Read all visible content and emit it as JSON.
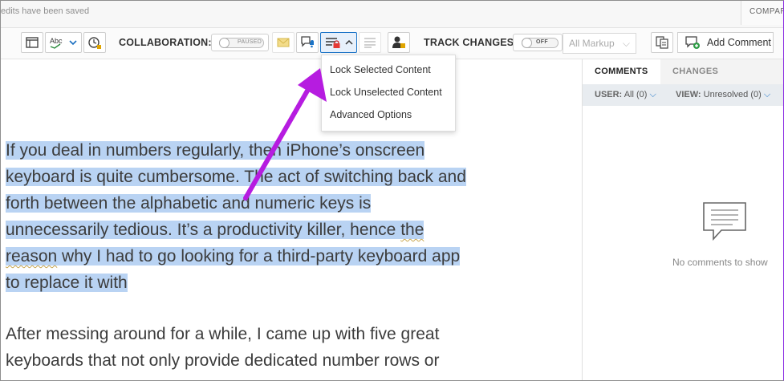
{
  "topbar": {
    "saved_text": "edits have been saved",
    "compare_label": "COMPARE"
  },
  "toolbar": {
    "collaboration_label": "COLLABORATION:",
    "collab_toggle_text": "PAUSED",
    "track_changes_label": "TRACK CHANGES:",
    "track_toggle_text": "OFF",
    "markup_select": "All Markup",
    "add_comment_label": "Add Comment"
  },
  "lock_menu": {
    "items": [
      "Lock Selected Content",
      "Lock Unselected Content",
      "Advanced Options"
    ]
  },
  "document": {
    "para1": {
      "lines": [
        "If you deal in numbers regularly, then iPhone’s onscreen",
        "keyboard is quite cumbersome. The act of switching back and",
        "forth between the alphabetic and numeric keys is",
        "unnecessarily tedious. It’s a productivity killer, hence the",
        "reason why I had to go looking for a third-party keyboard app",
        "to replace it with"
      ],
      "line4_plain": "unnecessarily tedious. It’s a productivity killer, hence ",
      "line4_marked": "the",
      "line5_marked": "reason",
      "line5_plain": " why I had to go looking for a third-party keyboard app"
    },
    "para2": {
      "lines": [
        "After messing around for a while, I came up with five great",
        "keyboards that not only provide dedicated number rows or"
      ]
    }
  },
  "panel": {
    "tab_comments": "COMMENTS",
    "tab_changes": "CHANGES",
    "user_label": "USER:",
    "user_value": "All (0)",
    "view_label": "VIEW:",
    "view_value": "Unresolved (0)",
    "empty_text": "No comments to show"
  },
  "colors": {
    "selection": "#b9d3f3",
    "annotation_arrow": "#b61ce0",
    "active_button": "#1a73c7"
  },
  "icons": [
    "layout-icon",
    "spellcheck-icon",
    "history-icon",
    "collab-chat-icon",
    "notify-user-icon",
    "lock-content-icon",
    "format-list-icon",
    "user-lock-icon",
    "compare-docs-icon",
    "add-comment-icon",
    "comment-bubble-icon"
  ]
}
